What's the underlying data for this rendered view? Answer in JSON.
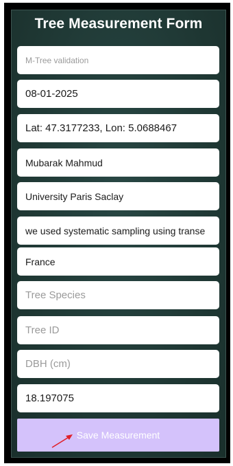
{
  "form": {
    "title": "Tree Measurement Form",
    "fields": [
      {
        "value": "",
        "placeholder": "M-Tree validation"
      },
      {
        "value": "08-01-2025",
        "placeholder": ""
      },
      {
        "value": "Lat: 47.3177233, Lon: 5.0688467",
        "placeholder": ""
      },
      {
        "value": "Mubarak Mahmud",
        "placeholder": ""
      },
      {
        "value": "University Paris Saclay",
        "placeholder": ""
      },
      {
        "value": "we used systematic sampling using transe",
        "placeholder": ""
      },
      {
        "value": "France",
        "placeholder": ""
      },
      {
        "value": "",
        "placeholder": "Tree Species"
      },
      {
        "value": "",
        "placeholder": "Tree ID"
      },
      {
        "value": "",
        "placeholder": "DBH (cm)"
      },
      {
        "value": "18.197075",
        "placeholder": ""
      }
    ],
    "save_label": "Save Measurement"
  },
  "colors": {
    "background": "#1f3a36",
    "button": "#d4c2fb",
    "arrow": "#e0202a"
  }
}
